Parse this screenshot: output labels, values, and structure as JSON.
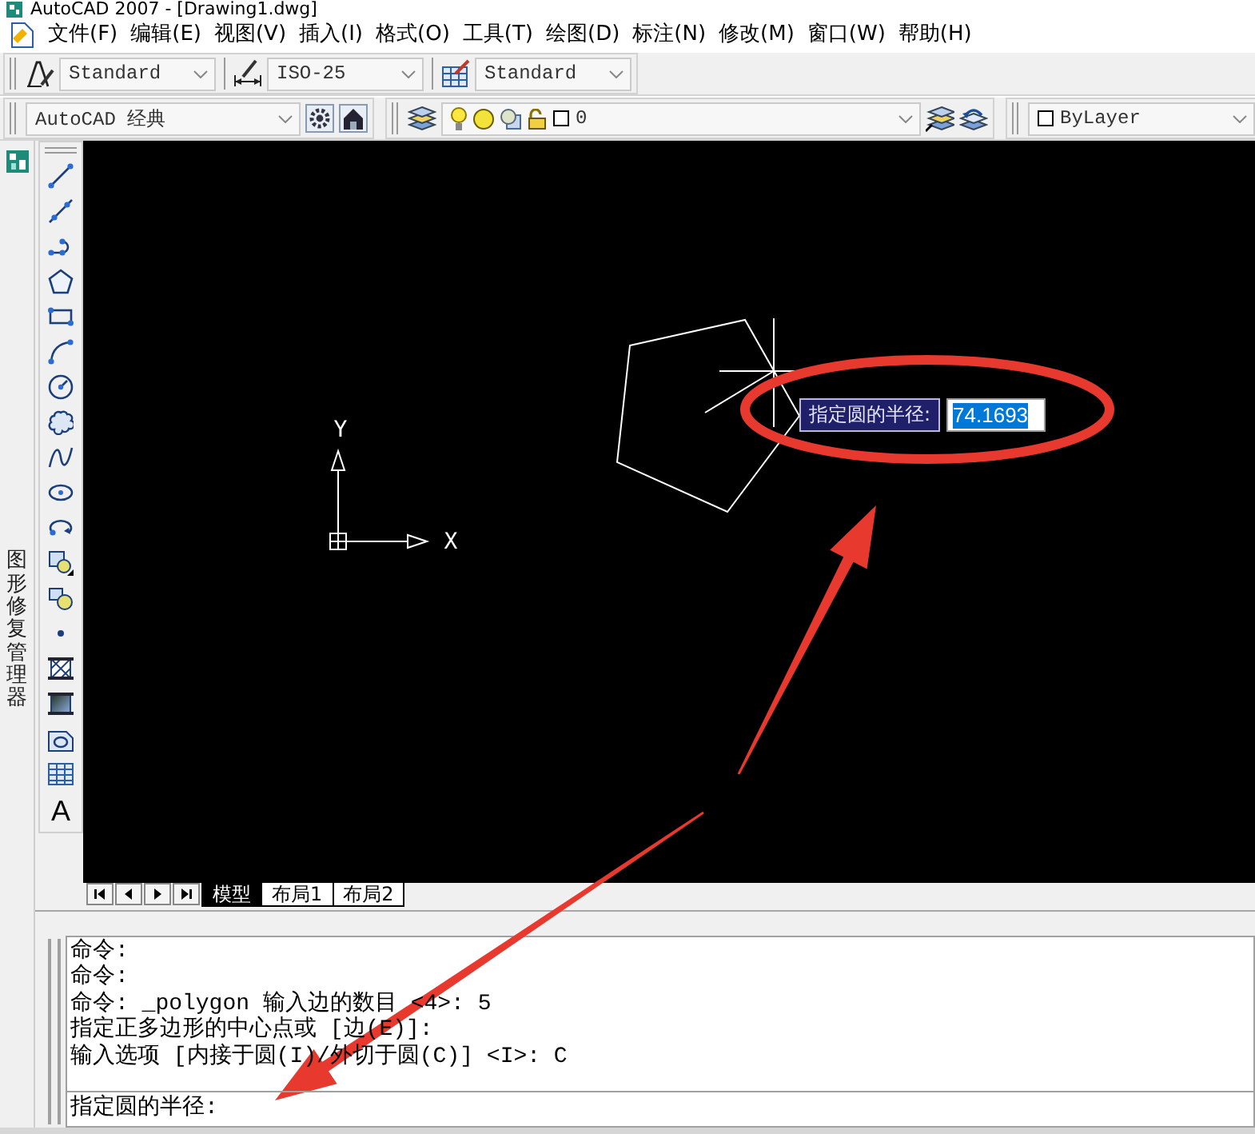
{
  "window": {
    "title": "AutoCAD 2007 - [Drawing1.dwg]"
  },
  "menu": [
    "文件(F)",
    "编辑(E)",
    "视图(V)",
    "插入(I)",
    "格式(O)",
    "工具(T)",
    "绘图(D)",
    "标注(N)",
    "修改(M)",
    "窗口(W)",
    "帮助(H)"
  ],
  "styles_toolbar": [
    {
      "kind": "text",
      "value": "Standard"
    },
    {
      "kind": "dimension",
      "value": "ISO-25"
    },
    {
      "kind": "table",
      "value": "Standard"
    }
  ],
  "workspaces_toolbar": {
    "value": "AutoCAD 经典"
  },
  "layers_toolbar": {
    "value": "0"
  },
  "properties_toolbar": {
    "value": "ByLayer"
  },
  "dock_panel": {
    "label": "图形修复管理器"
  },
  "draw_toolbar": {
    "text_tool": "A"
  },
  "canvas": {
    "ucs": {
      "x_label": "X",
      "y_label": "Y"
    },
    "dynamic_input": {
      "prompt": "指定圆的半径:",
      "value": "74.1693",
      "value_selected": true
    }
  },
  "layout_tabs": [
    {
      "label": "模型",
      "selected": true
    },
    {
      "label": "布局1",
      "selected": false
    },
    {
      "label": "布局2",
      "selected": false
    }
  ],
  "command_line": {
    "history": [
      "命令:",
      "命令:",
      "命令: _polygon 输入边的数目 <4>: 5",
      "指定正多边形的中心点或 [边(E)]:",
      "输入选项 [内接于圆(I)/外切于圆(C)] <I>: C"
    ],
    "prompt": "指定圆的半径:"
  },
  "annotations": [
    {
      "kind": "ellipse"
    },
    {
      "kind": "arrow"
    },
    {
      "kind": "arrow"
    }
  ]
}
